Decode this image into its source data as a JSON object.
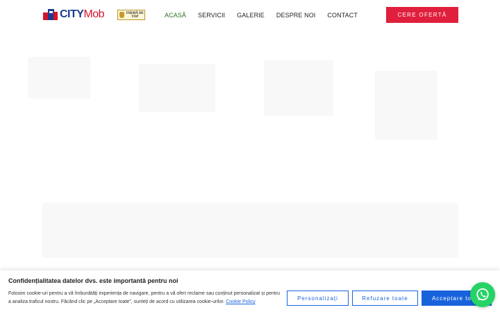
{
  "header": {
    "logo": {
      "city": "CITY",
      "mob": "Mob"
    },
    "badge": "FIRMĂ DE TOP",
    "nav": [
      {
        "label": "ACASĂ",
        "active": true
      },
      {
        "label": "SERVICII",
        "active": false
      },
      {
        "label": "GALERIE",
        "active": false
      },
      {
        "label": "DESPRE NOI",
        "active": false
      },
      {
        "label": "CONTACT",
        "active": false
      }
    ],
    "cta_label": "CERE OFERTĂ"
  },
  "cookie": {
    "title": "Confidențialitatea datelor dvs. este importantă pentru noi",
    "text": "Folosim cookie-uri pentru a vă îmbunătăți experiența de navigare, pentru a vă oferi reclame sau conținut personalizat și pentru a analiza traficul nostru. Făcând clic pe „Acceptare toate”, sunteți de acord cu utilizarea cookie-urilor.",
    "policy_link": "Cookie Policy",
    "buttons": {
      "customize": "Personalizați",
      "reject": "Refuzare toate",
      "accept": "Acceptare toate"
    }
  },
  "colors": {
    "accent_red": "#e01f3d",
    "nav_active": "#2f6b1f",
    "cookie_blue": "#1863dc",
    "whatsapp": "#25d366"
  },
  "icons": {
    "chat": "whatsapp-icon"
  }
}
